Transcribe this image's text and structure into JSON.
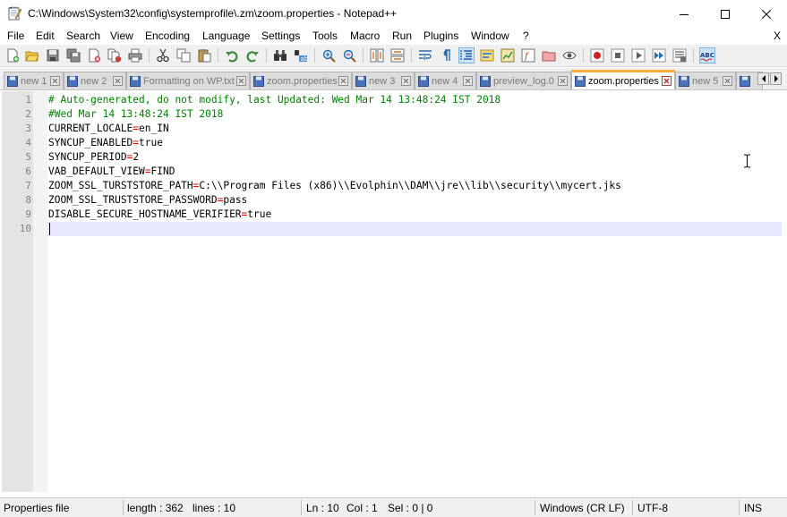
{
  "window": {
    "title": "C:\\Windows\\System32\\config\\systemprofile\\.zm\\zoom.properties - Notepad++",
    "icons": {
      "app": "notepad-icon",
      "minimize": "minimize-icon",
      "maximize": "maximize-icon",
      "close": "close-icon"
    }
  },
  "menu": {
    "items": [
      "File",
      "Edit",
      "Search",
      "View",
      "Encoding",
      "Language",
      "Settings",
      "Tools",
      "Macro",
      "Run",
      "Plugins",
      "Window",
      "?"
    ],
    "close_label": "X"
  },
  "toolbar": {
    "buttons": [
      "new-file",
      "open-file",
      "save",
      "save-all",
      "close",
      "close-all",
      "print",
      "cut",
      "copy",
      "paste",
      "undo",
      "redo",
      "find",
      "replace",
      "zoom-in",
      "zoom-out",
      "sync-vertical",
      "sync-horizontal",
      "word-wrap",
      "show-all-chars",
      "indent-guide",
      "user-defined-language",
      "doc-map",
      "function-list",
      "folder-as-workspace",
      "monitoring",
      "record-macro",
      "stop-record",
      "play-macro",
      "run-macro-multiple",
      "save-macro",
      "spell-check"
    ]
  },
  "tabs": [
    {
      "label": "new 1",
      "active": false
    },
    {
      "label": "new 2",
      "active": false
    },
    {
      "label": "Formatting on WP.txt",
      "active": false
    },
    {
      "label": "zoom.properties",
      "active": false
    },
    {
      "label": "new 3",
      "active": false
    },
    {
      "label": "new 4",
      "active": false
    },
    {
      "label": "preview_log.0",
      "active": false
    },
    {
      "label": "zoom.properties",
      "active": true
    },
    {
      "label": "new 5",
      "active": false
    },
    {
      "label": "",
      "active": false
    }
  ],
  "editor": {
    "lines": [
      {
        "num": "1",
        "text": "# Auto-generated, do not modify, last Updated: Wed Mar 14 13:48:24 IST 2018",
        "comment": true
      },
      {
        "num": "2",
        "text": "#Wed Mar 14 13:48:24 IST 2018",
        "comment": true
      },
      {
        "num": "3",
        "key": "CURRENT_LOCALE",
        "value": "en_IN"
      },
      {
        "num": "4",
        "key": "SYNCUP_ENABLED",
        "value": "true"
      },
      {
        "num": "5",
        "key": "SYNCUP_PERIOD",
        "value": "2"
      },
      {
        "num": "6",
        "key": "VAB_DEFAULT_VIEW",
        "value": "FIND"
      },
      {
        "num": "7",
        "key": "ZOOM_SSL_TURSTSTORE_PATH",
        "value": "C:\\\\Program Files (x86)\\\\Evolphin\\\\DAM\\\\jre\\\\lib\\\\security\\\\mycert.jks"
      },
      {
        "num": "8",
        "key": "ZOOM_SSL_TRUSTSTORE_PASSWORD",
        "value": "pass"
      },
      {
        "num": "9",
        "key": "DISABLE_SECURE_HOSTNAME_VERIFIER",
        "value": "true"
      },
      {
        "num": "10",
        "text": "",
        "comment": false
      }
    ],
    "operator": "="
  },
  "status": {
    "file_type": "Properties file",
    "length": "length : 362",
    "lines": "lines : 10",
    "ln": "Ln : 10",
    "col": "Col : 1",
    "sel": "Sel : 0 | 0",
    "eol": "Windows (CR LF)",
    "encoding": "UTF-8",
    "mode": "INS"
  },
  "colors": {
    "comment": "#008000",
    "operator": "#ff0000",
    "current_line": "#e8e8ff",
    "active_tab_accent": "#fbb03b"
  }
}
